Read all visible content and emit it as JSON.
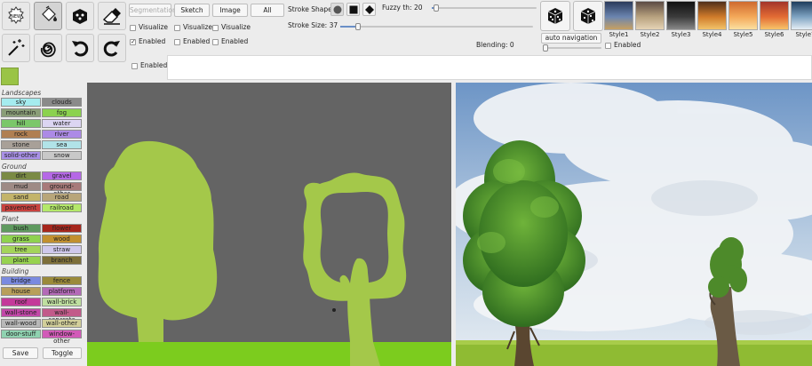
{
  "toolbar": {
    "segmentation_label": "Segmentation",
    "sketch_label": "Sketch",
    "image_label": "Image",
    "all_label": "All",
    "visualize_label": "Visualize",
    "enabled_label": "Enabled",
    "stroke_shape_label": "Stroke Shape",
    "stroke_size_label": "Stroke Size: 37",
    "fuzzy_label": "Fuzzy th: 20",
    "blending_label": "Blending: 0",
    "auto_navigation_label": "auto navigation",
    "enabled_row3_label": "Enabled"
  },
  "controls": {
    "stroke_size_fraction": 0.09,
    "fuzzy_fraction": 0.04,
    "blending_fraction": 0.0
  },
  "tools": [
    "new-icon",
    "paint-fill-icon",
    "dice-palette-icon",
    "eraser-icon",
    "magic-wand-icon",
    "spiral-icon",
    "undo-icon",
    "redo-icon"
  ],
  "styles": [
    {
      "label": "Style1",
      "colors": [
        "#2a3a5a",
        "#6b85b0",
        "#c7a062"
      ]
    },
    {
      "label": "Style2",
      "colors": [
        "#5b4a43",
        "#b8a27f",
        "#e5d3b5"
      ]
    },
    {
      "label": "Style3",
      "colors": [
        "#111111",
        "#3c3c3c",
        "#888888"
      ]
    },
    {
      "label": "Style4",
      "colors": [
        "#512f1a",
        "#d07b2a",
        "#f2c36a"
      ]
    },
    {
      "label": "Style5",
      "colors": [
        "#cf6a2f",
        "#f4a95a",
        "#fbe0a0"
      ]
    },
    {
      "label": "Style6",
      "colors": [
        "#a3352a",
        "#e36c34",
        "#f7c46a"
      ]
    },
    {
      "label": "Style7",
      "colors": [
        "#1d3c5c",
        "#7fa3c2",
        "#e5eef5"
      ]
    }
  ],
  "palette": {
    "groups": [
      {
        "title": "Landscapes",
        "chips": [
          {
            "label": "sky",
            "color": "#a5ecef"
          },
          {
            "label": "clouds",
            "color": "#8a8a8a"
          },
          {
            "label": "mountain",
            "color": "#8a9e78"
          },
          {
            "label": "fog",
            "color": "#8bd24f"
          },
          {
            "label": "hill",
            "color": "#7bc76a"
          },
          {
            "label": "water",
            "color": "#dcd5f2"
          },
          {
            "label": "rock",
            "color": "#b07f52"
          },
          {
            "label": "river",
            "color": "#ac8ae6"
          },
          {
            "label": "stone",
            "color": "#a8a098"
          },
          {
            "label": "sea",
            "color": "#b1e3e8"
          },
          {
            "label": "solid-other",
            "color": "#a890e6"
          },
          {
            "label": "snow",
            "color": "#c8c8c8"
          }
        ]
      },
      {
        "title": "Ground",
        "chips": [
          {
            "label": "dirt",
            "color": "#7a8a44"
          },
          {
            "label": "gravel",
            "color": "#b568e6"
          },
          {
            "label": "mud",
            "color": "#9e8a85"
          },
          {
            "label": "ground-other",
            "color": "#a87a7a"
          },
          {
            "label": "sand",
            "color": "#c3b46a"
          },
          {
            "label": "road",
            "color": "#b8a67a"
          },
          {
            "label": "pavement",
            "color": "#c9433f"
          },
          {
            "label": "railroad",
            "color": "#b4e86a"
          }
        ]
      },
      {
        "title": "Plant",
        "chips": [
          {
            "label": "bush",
            "color": "#5f9a5f"
          },
          {
            "label": "flower",
            "color": "#a6261c"
          },
          {
            "label": "grass",
            "color": "#8fd24f"
          },
          {
            "label": "wood",
            "color": "#c2902f"
          },
          {
            "label": "tree",
            "color": "#a4d45a"
          },
          {
            "label": "straw",
            "color": "#cfc8ec"
          },
          {
            "label": "plant",
            "color": "#97d24f"
          },
          {
            "label": "branch",
            "color": "#7d6f3a"
          }
        ]
      },
      {
        "title": "Building",
        "chips": [
          {
            "label": "bridge",
            "color": "#7a8ae0"
          },
          {
            "label": "fence",
            "color": "#9a8a3a"
          },
          {
            "label": "house",
            "color": "#b89f5a"
          },
          {
            "label": "platform",
            "color": "#b46ab8"
          },
          {
            "label": "roof",
            "color": "#c43a9a"
          },
          {
            "label": "wall-brick",
            "color": "#bfe0a0"
          },
          {
            "label": "wall-stone",
            "color": "#c247a8"
          },
          {
            "label": "wall-concrete",
            "color": "#c25a8a"
          },
          {
            "label": "wall-wood",
            "color": "#b8b8b8"
          },
          {
            "label": "wall-other",
            "color": "#d2cf9a"
          },
          {
            "label": "door-stuff",
            "color": "#8fd2b0"
          },
          {
            "label": "window-other",
            "color": "#d25ab8"
          }
        ]
      }
    ],
    "save_label": "Save",
    "toggle_label": "Toggle"
  },
  "colors": {
    "tree_label": "#a4c84a",
    "grass_label": "#7ccc1e",
    "canvas_bg": "#646464"
  }
}
